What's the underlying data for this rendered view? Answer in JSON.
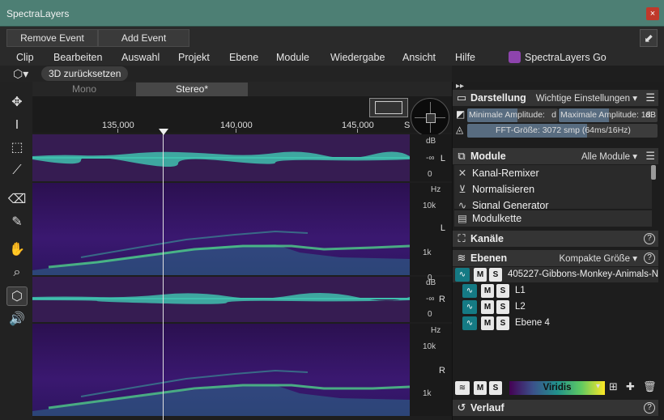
{
  "window": {
    "title": "SpectraLayers",
    "close_glyph": "×"
  },
  "events": {
    "remove_label": "Remove Event",
    "add_label": "Add Event",
    "collapse_glyph": "⬋"
  },
  "menu": [
    "Clip",
    "Bearbeiten",
    "Auswahl",
    "Projekt",
    "Ebene",
    "Module",
    "Wiedergabe",
    "Ansicht",
    "Hilfe"
  ],
  "brand": "SpectraLayers Go",
  "view": {
    "reset_label": "3D zurücksetzen"
  },
  "tabs": {
    "mono": "Mono",
    "stereo": "Stereo*"
  },
  "ruler": {
    "labels": [
      "135.000",
      "140.000",
      "145.000"
    ],
    "unit": "S"
  },
  "tracks": {
    "wave_top": {
      "db": "dB",
      "inf": "-∞",
      "zero": "0",
      "chan": "L"
    },
    "spec_top": {
      "hz": "Hz",
      "k10": "10k",
      "k1": "1k",
      "chan": "L"
    },
    "wave_bot": {
      "zero_top": "0",
      "db": "dB",
      "inf": "-∞",
      "zero": "0",
      "chan": "R"
    },
    "spec_bot": {
      "hz": "Hz",
      "k10": "10k",
      "k1": "1k",
      "chan": "R"
    }
  },
  "panel": {
    "display": {
      "title": "Darstellung",
      "option": "Wichtige Einstellungen",
      "min_amp": "Minimale Amplitude:",
      "min_amp_unit": "d",
      "max_amp": "Maximale Amplitude: 18",
      "max_amp_unit": "dB",
      "fft": "FFT-Größe: 3072 smp (64ms/16Hz)"
    },
    "modules": {
      "title": "Module",
      "option": "Alle Module",
      "items": [
        "Kanal-Remixer",
        "Normalisieren",
        "Signal Generator"
      ],
      "chain": "Modulkette"
    },
    "channels": {
      "title": "Kanäle"
    },
    "layers": {
      "title": "Ebenen",
      "option": "Kompakte Größe",
      "root": "405227-Gibbons-Monkey-Animals-N",
      "children": [
        "L1",
        "L2",
        "Ebene 4"
      ],
      "m": "M",
      "s": "S",
      "colormap": "Viridis"
    },
    "history": {
      "title": "Verlauf"
    }
  },
  "colors": {
    "titlebar": "#4d7f74",
    "waveform": "#3fbfae",
    "accent": "#157a84"
  },
  "icons": [
    "move-icon",
    "time-select-icon",
    "rect-select-icon",
    "brush-select-icon",
    "eraser-icon",
    "pen-icon",
    "hand-icon",
    "zoom-icon",
    "cube-icon",
    "speaker-icon"
  ]
}
